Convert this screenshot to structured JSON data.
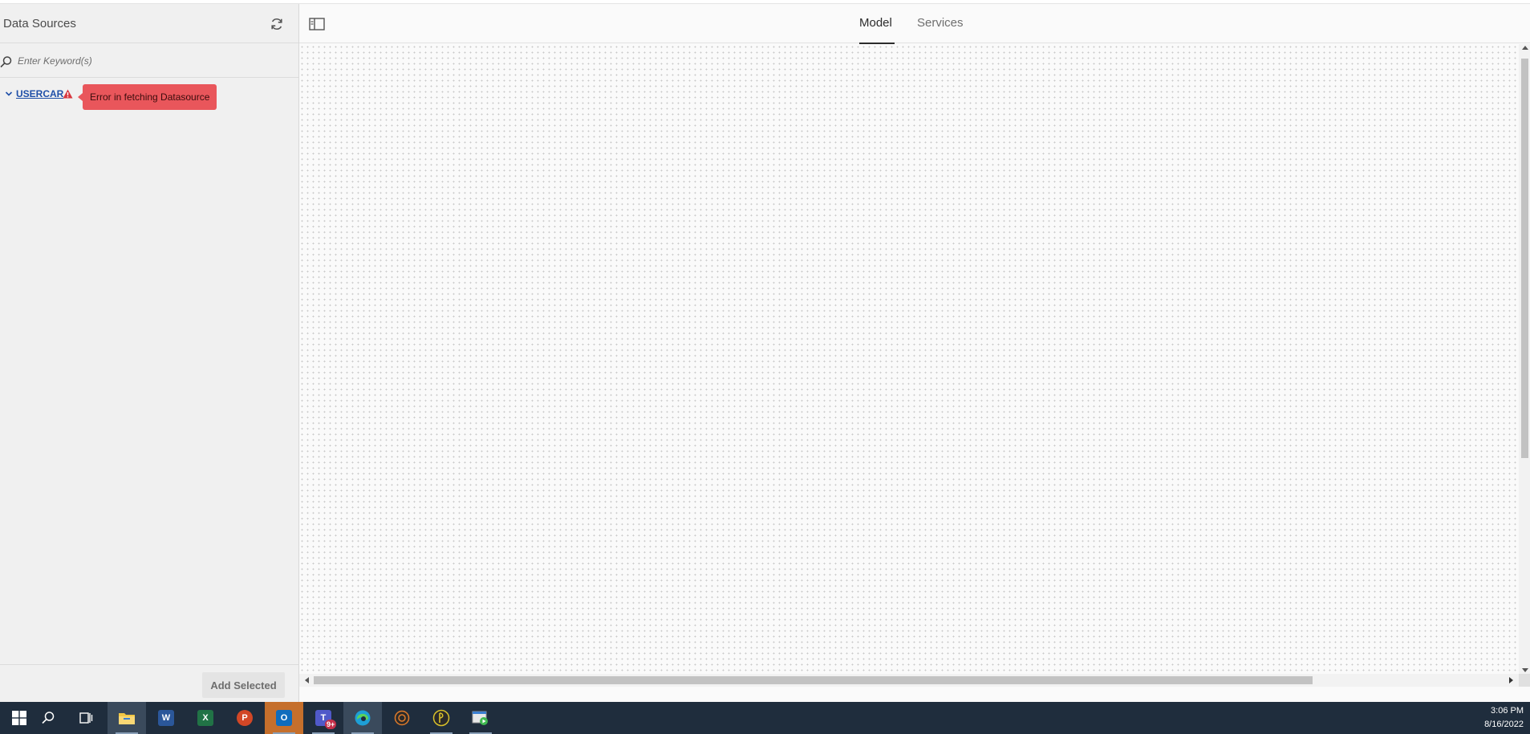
{
  "sidebar": {
    "title": "Data Sources",
    "search_placeholder": "Enter Keyword(s)",
    "datasource": {
      "name": "USERCAR",
      "error_message": "Error in fetching Datasource"
    },
    "add_selected_label": "Add Selected"
  },
  "main": {
    "tabs": [
      {
        "label": "Model",
        "active": true
      },
      {
        "label": "Services",
        "active": false
      }
    ]
  },
  "taskbar": {
    "apps": [
      {
        "name": "start",
        "icon": "windows-icon"
      },
      {
        "name": "search",
        "icon": "search-icon"
      },
      {
        "name": "task-view",
        "icon": "task-view-icon"
      },
      {
        "name": "file-explorer",
        "icon": "folder-icon",
        "color": "#f2c744"
      },
      {
        "name": "word",
        "icon": "word-icon",
        "letter": "W",
        "color": "#2b579a"
      },
      {
        "name": "excel",
        "icon": "excel-icon",
        "letter": "X",
        "color": "#217346"
      },
      {
        "name": "powerpoint",
        "icon": "powerpoint-icon",
        "letter": "P",
        "color": "#d24726"
      },
      {
        "name": "outlook",
        "icon": "outlook-icon",
        "letter": "O",
        "color": "#0f6cbd"
      },
      {
        "name": "teams",
        "icon": "teams-icon",
        "letter": "T",
        "color": "#5059c9",
        "badge": "9+"
      },
      {
        "name": "edge",
        "icon": "edge-icon",
        "color": "#1e9fd6"
      },
      {
        "name": "app-orange",
        "icon": "circle-app-icon",
        "color": "#e07b2a"
      },
      {
        "name": "app-yellow",
        "icon": "pen-app-icon",
        "color": "#d9c12a"
      },
      {
        "name": "app-green",
        "icon": "media-app-icon",
        "color": "#3fb950"
      }
    ],
    "time": "3:06 PM",
    "date": "8/16/2022"
  },
  "colors": {
    "error": "#e9565b",
    "link": "#1f4fa8",
    "taskbar": "#1f2d3d"
  }
}
